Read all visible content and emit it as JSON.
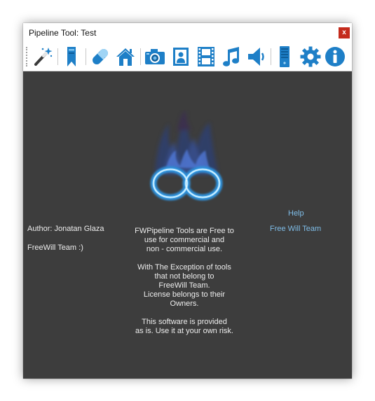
{
  "window": {
    "title": "Pipeline Tool: Test",
    "close_label": "x"
  },
  "toolbar": {
    "buttons": [
      {
        "name": "magic-wand-icon"
      },
      {
        "name": "bookmark-icon"
      },
      {
        "name": "pill-icon"
      },
      {
        "name": "home-icon"
      },
      {
        "name": "camera-icon"
      },
      {
        "name": "portrait-icon"
      },
      {
        "name": "film-strip-icon"
      },
      {
        "name": "music-note-icon"
      },
      {
        "name": "speaker-icon"
      },
      {
        "name": "computer-tower-icon"
      },
      {
        "name": "gear-icon"
      },
      {
        "name": "info-icon"
      }
    ]
  },
  "content": {
    "author_line": "Author: Jonatan Glaza",
    "team_line": "FreeWill Team :)",
    "help_link": "Help",
    "team_link": "Free Will Team",
    "info": {
      "p1_l1": "FWPipeline Tools are Free to",
      "p1_l2": "use for commercial and",
      "p1_l3": "non - commercial use.",
      "p2_l1": "With The Exception of tools",
      "p2_l2": "that not belong to",
      "p2_l3": "FreeWill Team.",
      "p2_l4": "License belongs to their",
      "p2_l5": "Owners.",
      "p3_l1": "This software is provided",
      "p3_l2": "as is. Use it at your own risk."
    }
  },
  "colors": {
    "background": "#3d3d3d",
    "text": "#ededed",
    "link": "#7fbde8",
    "close": "#c42b1c",
    "icon_blue": "#1e7fc7"
  }
}
